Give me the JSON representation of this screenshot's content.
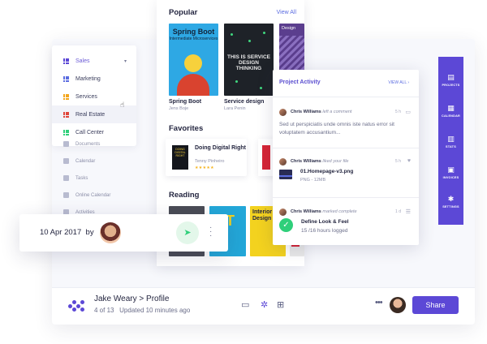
{
  "sidebar": {
    "items": [
      {
        "label": "Sales",
        "color": "#5c48d6"
      },
      {
        "label": "Marketing",
        "color": "#5b6ce0"
      },
      {
        "label": "Services",
        "color": "#f3a51c"
      },
      {
        "label": "Real Estate",
        "color": "#e0453a"
      },
      {
        "label": "Call Center",
        "color": "#2fcf7a"
      }
    ],
    "sub_items": [
      "Documents",
      "Calendar",
      "Tasks",
      "Online Calendar",
      "Activities"
    ]
  },
  "library": {
    "popular_title": "Popular",
    "view_all": "View All",
    "popular": [
      {
        "cover_title": "Spring Boot",
        "cover_subtitle": "Intermediate Microservices",
        "title": "Spring Boot",
        "author": "Jens Boje"
      },
      {
        "cover_title": "THIS IS SERVICE DESIGN THINKING",
        "title": "Service design",
        "author": "Lara Penin"
      },
      {
        "cover_title": "Design"
      }
    ],
    "favorites_title": "Favorites",
    "favorites": [
      {
        "cover_title": "DOING DIGITAL RIGHT",
        "title": "Doing Digital Right",
        "author": "Tenny Pinheiro",
        "stars": "★★★★★"
      }
    ],
    "reading_title": "Reading",
    "reading": [
      {
        "cover_title": ""
      },
      {
        "cover_title": "INT"
      },
      {
        "cover_title": "Interior Design"
      },
      {
        "cover_title": ""
      }
    ]
  },
  "activity": {
    "title": "Project Activity",
    "view_all": "VIEW ALL",
    "items": [
      {
        "user": "Chris Williams",
        "action": "left a comment",
        "time": "5 h",
        "icon": "comment-icon",
        "body": "Sed ut perspiciatis unde omnis iste natus error sit voluptatem accusantium..."
      },
      {
        "user": "Chris Williams",
        "action": "liked your file",
        "time": "5 h",
        "icon": "heart-icon",
        "file": "01.Homepage-v3.png",
        "meta": "PNG - 12MB"
      },
      {
        "user": "Chris Williams",
        "action": "marked complete",
        "time": "1 d",
        "icon": "list-icon",
        "task": "Define Look & Feel",
        "progress": "15 /16 hours logged"
      }
    ]
  },
  "right_nav": [
    "PROJECTS",
    "CALENDAR",
    "STATS",
    "INVOICES",
    "SETTINGS"
  ],
  "footer": {
    "name": "Jake Weary",
    "separator": ">",
    "page": "Profile",
    "counter": "4 of 13",
    "updated": "Updated 10 minutes ago",
    "share": "Share"
  },
  "message": {
    "date": "10 Apr 2017",
    "by": "by"
  },
  "colors": {
    "accent": "#5c48d6",
    "success": "#2fcf7a"
  }
}
